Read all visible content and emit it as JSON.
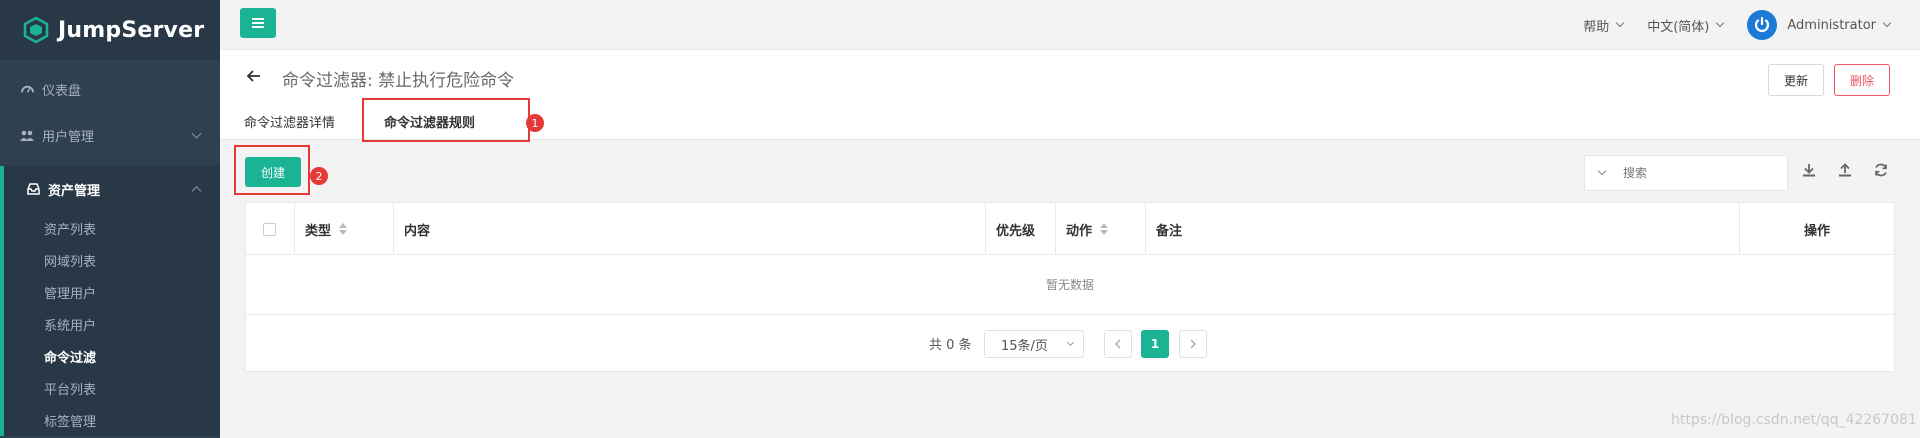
{
  "app": {
    "name": "JumpServer"
  },
  "sidebar": {
    "items": [
      {
        "label": "仪表盘",
        "icon": "dashboard-icon"
      },
      {
        "label": "用户管理",
        "icon": "users-icon"
      },
      {
        "label": "资产管理",
        "icon": "inbox-icon"
      }
    ],
    "submenu": [
      {
        "label": "资产列表"
      },
      {
        "label": "网域列表"
      },
      {
        "label": "管理用户"
      },
      {
        "label": "系统用户"
      },
      {
        "label": "命令过滤"
      },
      {
        "label": "平台列表"
      },
      {
        "label": "标签管理"
      }
    ]
  },
  "topbar": {
    "help": "帮助",
    "language": "中文(简体)",
    "user": "Administrator"
  },
  "page": {
    "title": "命令过滤器: 禁止执行危险命令",
    "update_label": "更新",
    "delete_label": "删除",
    "tabs": [
      {
        "label": "命令过滤器详情"
      },
      {
        "label": "命令过滤器规则"
      }
    ],
    "markers": [
      "1",
      "2"
    ]
  },
  "toolbar": {
    "create_label": "创建",
    "search_placeholder": "搜索"
  },
  "table": {
    "columns": [
      "类型",
      "内容",
      "优先级",
      "动作",
      "备注",
      "操作"
    ],
    "empty_text": "暂无数据"
  },
  "pagination": {
    "total": "共 0 条",
    "page_size": "15条/页",
    "current_page": "1"
  },
  "watermark": "https://blog.csdn.net/qq_42267081",
  "colors": {
    "accent": "#1ab394",
    "sidebar": "#2f4050",
    "danger": "#ed5565",
    "annotation": "#e53935"
  }
}
